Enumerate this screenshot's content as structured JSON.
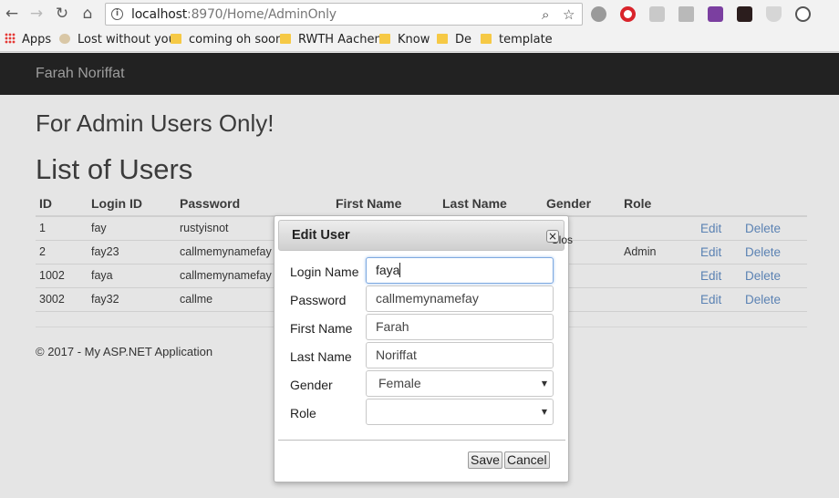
{
  "browser": {
    "url_host": "localhost",
    "url_rest": ":8970/Home/AdminOnly",
    "bookmarks": [
      {
        "label": "Apps",
        "type": "apps"
      },
      {
        "label": "Lost without you",
        "type": "page"
      },
      {
        "label": "coming oh soon",
        "type": "folder"
      },
      {
        "label": "RWTH Aachen",
        "type": "folder"
      },
      {
        "label": "Know",
        "type": "folder"
      },
      {
        "label": "De",
        "type": "folder"
      },
      {
        "label": "template",
        "type": "folder"
      }
    ]
  },
  "navbar": {
    "brand": "Farah Noriffat"
  },
  "page": {
    "title": "For Admin Users Only!",
    "list_title": "List of Users",
    "footer": "© 2017 - My ASP.NET Application"
  },
  "table": {
    "headers": [
      "ID",
      "Login ID",
      "Password",
      "First Name",
      "Last Name",
      "Gender",
      "Role"
    ],
    "rows": [
      {
        "id": "1",
        "login": "fay",
        "password": "rustyisnot",
        "role": "",
        "edit": "Edit",
        "delete": "Delete"
      },
      {
        "id": "2",
        "login": "fay23",
        "password": "callmemynamefay",
        "role": "Admin",
        "edit": "Edit",
        "delete": "Delete"
      },
      {
        "id": "1002",
        "login": "faya",
        "password": "callmemynamefay",
        "role": "",
        "edit": "Edit",
        "delete": "Delete"
      },
      {
        "id": "3002",
        "login": "fay32",
        "password": "callme",
        "role": "",
        "edit": "Edit",
        "delete": "Delete"
      }
    ]
  },
  "modal": {
    "title": "Edit User",
    "close_text": "Clos",
    "close_icon": "×",
    "fields": {
      "login_label": "Login Name",
      "login_value": "faya",
      "password_label": "Password",
      "password_value": "callmemynamefay",
      "first_label": "First Name",
      "first_value": "Farah",
      "last_label": "Last Name",
      "last_value": "Noriffat",
      "gender_label": "Gender",
      "gender_value": "Female",
      "role_label": "Role",
      "role_value": ""
    },
    "save_label": "Save",
    "cancel_label": "Cancel"
  }
}
